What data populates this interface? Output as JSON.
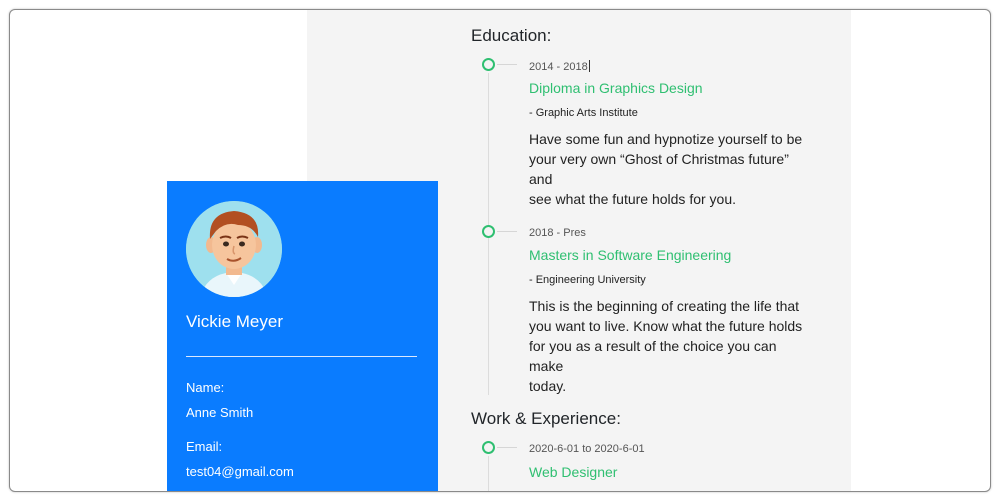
{
  "education": {
    "heading": "Education:",
    "items": [
      {
        "date": "2014 - 2018",
        "title": "Diploma in Graphics Design",
        "org": "- Graphic Arts Institute",
        "desc_lines": [
          "Have some fun and hypnotize yourself to be",
          "your very own “Ghost of Christmas future” and",
          "see what the future holds for you."
        ]
      },
      {
        "date": "2018 - Pres",
        "title": "Masters in Software Engineering",
        "org": "- Engineering University",
        "desc_lines": [
          "This is the beginning of creating the life that",
          "you want to live. Know what the future holds",
          "for you as a result of the choice you can make",
          "today."
        ]
      }
    ]
  },
  "work": {
    "heading": "Work & Experience:",
    "items": [
      {
        "date": "2020-6-01 to 2020-6-01",
        "title": "Web Designer"
      }
    ]
  },
  "profile": {
    "name": "Vickie Meyer",
    "fields": [
      {
        "label": "Name:",
        "value": "Anne Smith"
      },
      {
        "label": "Email:",
        "value": "test04@gmail.com"
      }
    ]
  },
  "colors": {
    "accent_green": "#2fbf71",
    "card_blue": "#0a7cff",
    "panel_bg": "#f4f4f4"
  }
}
